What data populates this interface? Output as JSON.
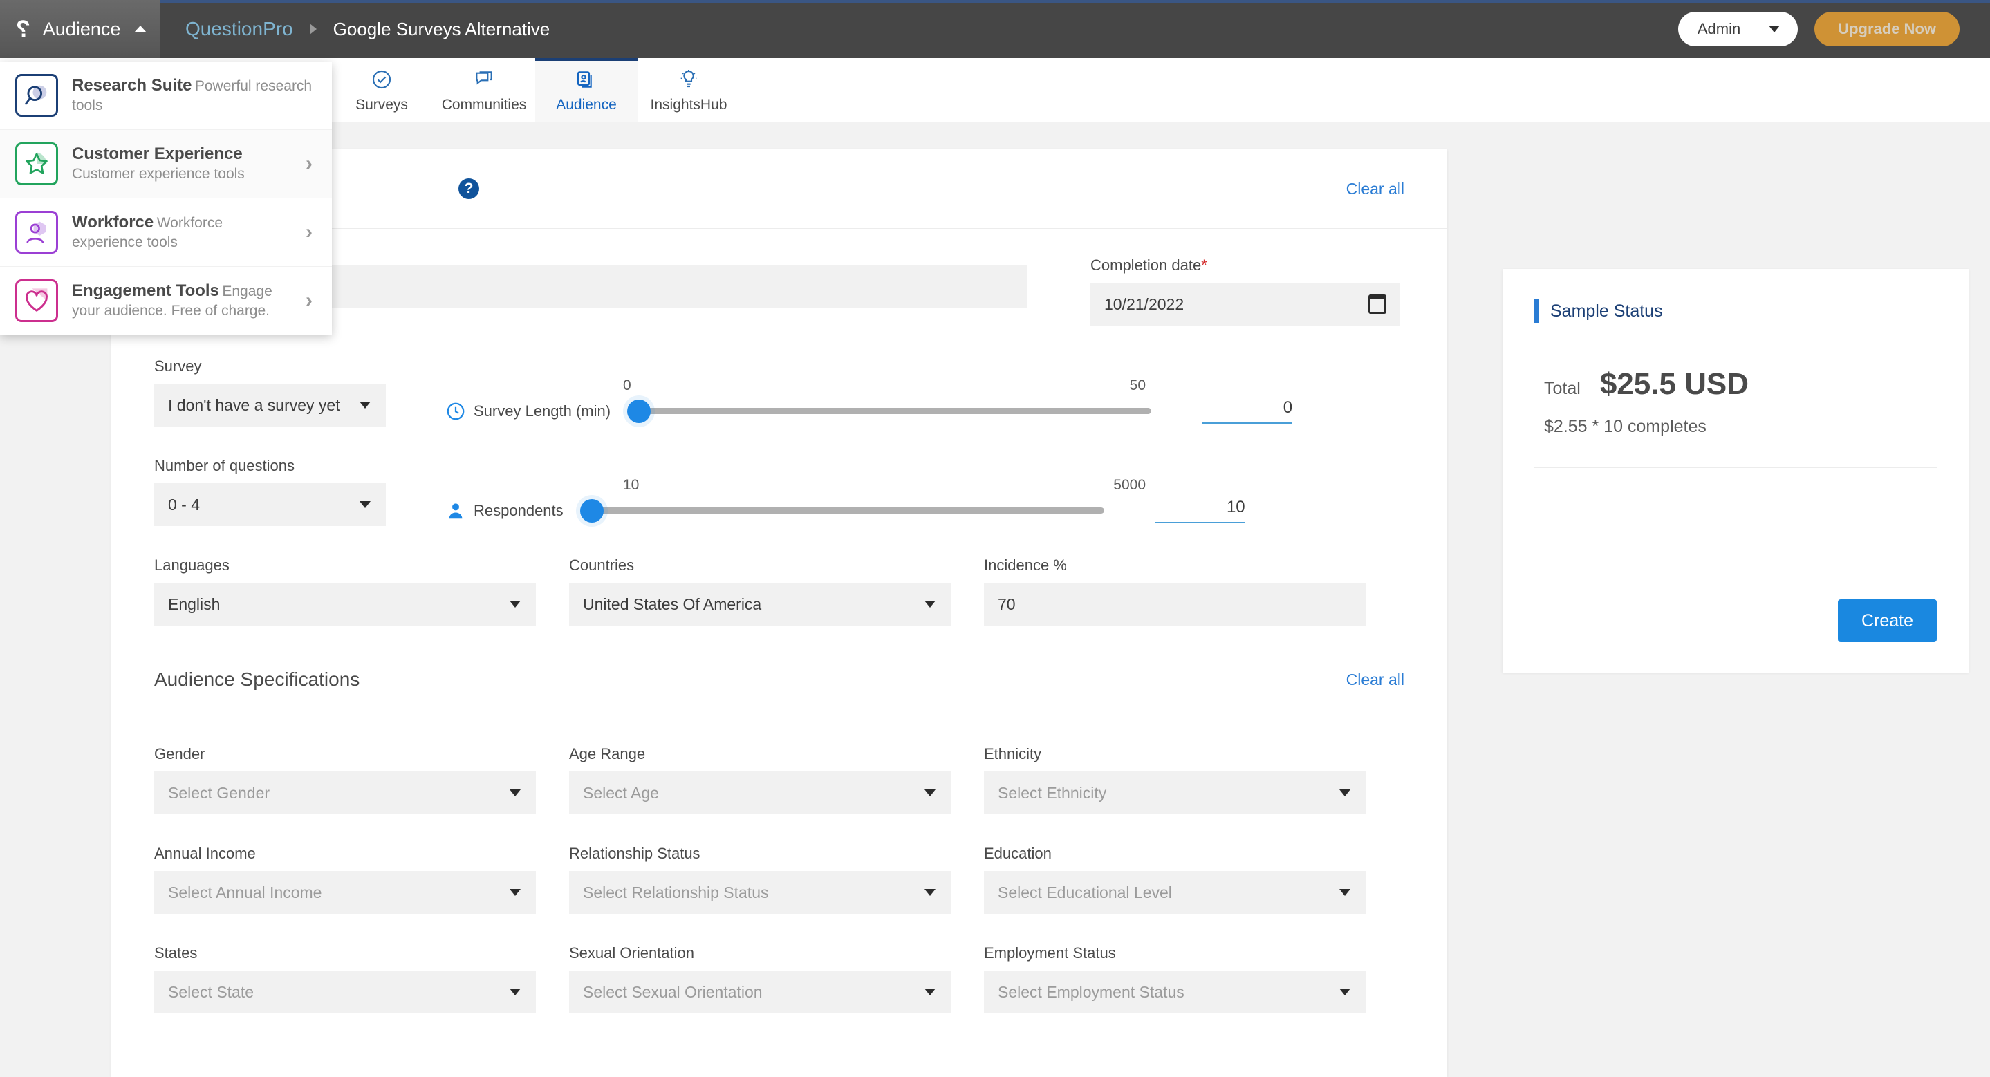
{
  "topbar": {
    "brand_logo_glyph": "?",
    "brand_label": "Audience",
    "breadcrumb_root": "QuestionPro",
    "breadcrumb_current": "Google Surveys Alternative",
    "admin_label": "Admin",
    "upgrade_label": "Upgrade Now",
    "accent_color": "#3a5684",
    "upgrade_color": "#cf9235"
  },
  "tabs": [
    {
      "label": "Surveys",
      "icon": "check-circle-icon",
      "active": false
    },
    {
      "label": "Communities",
      "icon": "chat-bubble-icon",
      "active": false
    },
    {
      "label": "Audience",
      "icon": "audience-cards-icon",
      "active": true
    },
    {
      "label": "InsightsHub",
      "icon": "lightbulb-icon",
      "active": false
    }
  ],
  "dropdown": {
    "items": [
      {
        "title": "Research Suite",
        "subtitle": "Powerful research tools",
        "icon": "magnifier-icon",
        "color": "#1b3f75",
        "chevron": false
      },
      {
        "title": "Customer Experience",
        "subtitle": "Customer experience tools",
        "icon": "star-icon",
        "color": "#22a45d",
        "chevron": true
      },
      {
        "title": "Workforce",
        "subtitle": "Workforce experience tools",
        "icon": "person-hex-icon",
        "color": "#9b3fd4",
        "chevron": true
      },
      {
        "title": "Engagement Tools",
        "subtitle": "Engage your audience. Free of charge.",
        "icon": "heart-icon",
        "color": "#cc2f8e",
        "chevron": true
      }
    ],
    "chevron_glyph": "›"
  },
  "main": {
    "help_icon_glyph": "?",
    "clear_all_top": "Clear all",
    "survey_name": {
      "label": "",
      "value": ""
    },
    "completion_date": {
      "label": "Completion date",
      "required_marker": "*",
      "value": "10/21/2022"
    },
    "survey": {
      "label": "Survey",
      "value": "I don't have a survey yet"
    },
    "num_questions": {
      "label": "Number of questions",
      "value": "0 - 4"
    },
    "survey_length": {
      "name": "Survey Length (min)",
      "icon": "clock-icon",
      "min_label": "0",
      "max_label": "50",
      "value": "0",
      "fill_percent": 0
    },
    "respondents": {
      "name": "Respondents",
      "icon": "person-icon",
      "min_label": "10",
      "max_label": "5000",
      "value": "10",
      "fill_percent": 0
    },
    "languages": {
      "label": "Languages",
      "value": "English",
      "placeholder": false
    },
    "countries": {
      "label": "Countries",
      "value": "United States Of America",
      "placeholder": false
    },
    "incidence": {
      "label": "Incidence %",
      "value": "70"
    },
    "spec_section": {
      "title": "Audience Specifications",
      "clear_all": "Clear all"
    },
    "specs": [
      {
        "label": "Gender",
        "placeholder": "Select Gender"
      },
      {
        "label": "Age Range",
        "placeholder": "Select Age"
      },
      {
        "label": "Ethnicity",
        "placeholder": "Select Ethnicity"
      },
      {
        "label": "Annual Income",
        "placeholder": "Select Annual Income"
      },
      {
        "label": "Relationship Status",
        "placeholder": "Select Relationship Status"
      },
      {
        "label": "Education",
        "placeholder": "Select Educational Level"
      },
      {
        "label": "States",
        "placeholder": "Select State"
      },
      {
        "label": "Sexual Orientation",
        "placeholder": "Select Sexual Orientation"
      },
      {
        "label": "Employment Status",
        "placeholder": "Select Employment Status"
      }
    ]
  },
  "sidepanel": {
    "title": "Sample Status",
    "total_label": "Total",
    "total_value": "$25.5 USD",
    "breakdown": "$2.55 * 10 completes",
    "create_label": "Create",
    "accent_color": "#2a7cd4",
    "create_color": "#1a88e0"
  }
}
